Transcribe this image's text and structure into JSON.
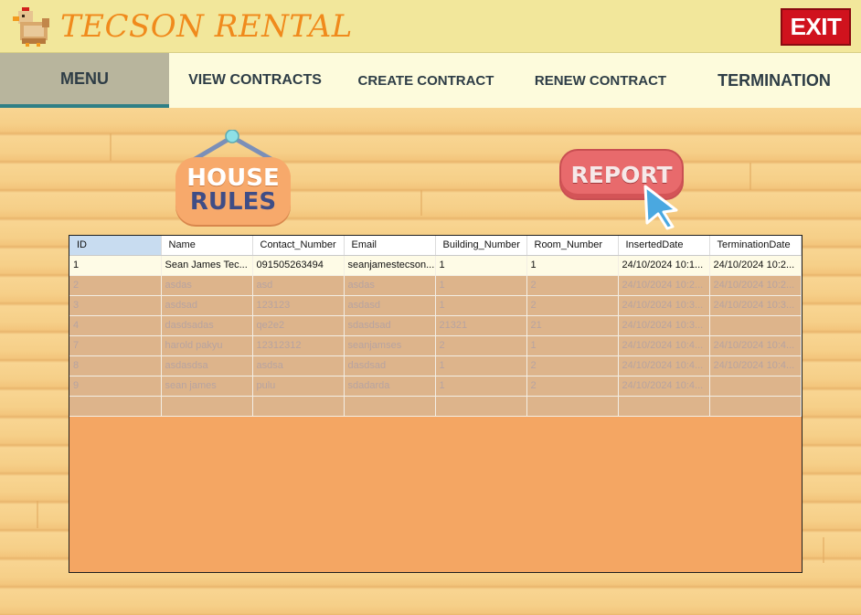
{
  "header": {
    "title": "TECSON RENTAL",
    "exit_label": "EXIT",
    "logo_icon": "chicken-icon"
  },
  "nav": {
    "menu": "MENU",
    "view_contracts": "VIEW CONTRACTS",
    "create_contract": "CREATE CONTRACT",
    "renew_contract": "RENEW CONTRACT",
    "termination": "TERMINATION"
  },
  "house_rules": {
    "line1": "HOUSE",
    "line2": "RULES"
  },
  "report": {
    "label": "REPORT"
  },
  "table": {
    "columns": [
      "ID",
      "Name",
      "Contact_Number",
      "Email",
      "Building_Number",
      "Room_Number",
      "InsertedDate",
      "TerminationDate"
    ],
    "rows": [
      [
        "1",
        "Sean James Tec...",
        "091505263494",
        "seanjamestecson...",
        "1",
        "1",
        "24/10/2024 10:1...",
        "24/10/2024 10:2..."
      ],
      [
        "2",
        "asdas",
        "asd",
        "asdas",
        "1",
        "2",
        "24/10/2024 10:2...",
        "24/10/2024 10:2..."
      ],
      [
        "3",
        "asdsad",
        "123123",
        "asdasd",
        "1",
        "2",
        "24/10/2024 10:3...",
        "24/10/2024 10:3..."
      ],
      [
        "4",
        "dasdsadas",
        "qe2e2",
        "sdasdsad",
        "21321",
        "21",
        "24/10/2024 10:3...",
        ""
      ],
      [
        "7",
        "harold pakyu",
        "12312312",
        "seanjamses",
        "2",
        "1",
        "24/10/2024 10:4...",
        "24/10/2024 10:4..."
      ],
      [
        "8",
        "asdasdsa",
        "asdsa",
        "dasdsad",
        "1",
        "2",
        "24/10/2024 10:4...",
        "24/10/2024 10:4..."
      ],
      [
        "9",
        "sean james",
        "pulu",
        "sdadarda",
        "1",
        "2",
        "24/10/2024 10:4...",
        ""
      ],
      [
        "",
        "",
        "",
        "",
        "",
        "",
        "",
        ""
      ]
    ]
  },
  "colors": {
    "header_bg": "#f2e79b",
    "title": "#f08a1c",
    "exit_bg": "#d0121d",
    "nav_active_bg": "#b8b59d",
    "nav_active_underline": "#2f7f86",
    "grid_bg": "#f4a663"
  }
}
